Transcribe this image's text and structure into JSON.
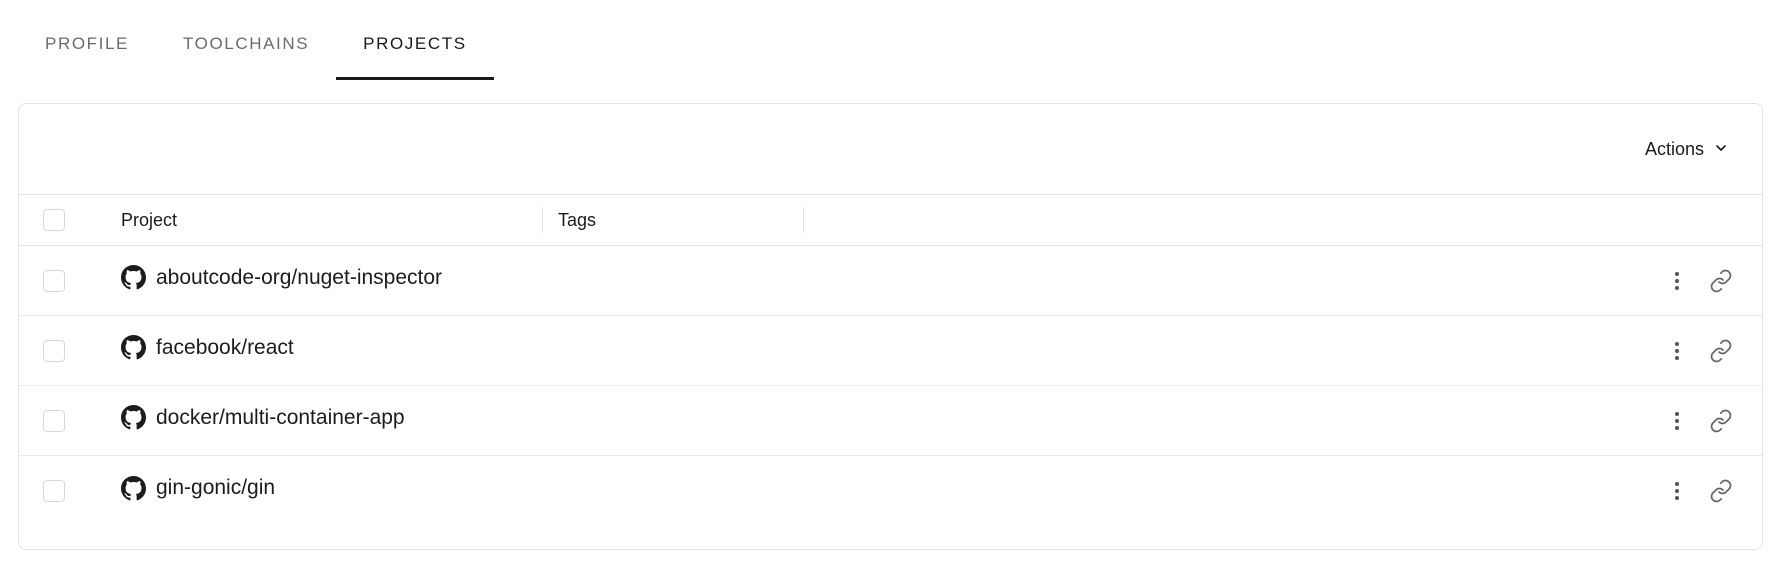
{
  "tabs": [
    {
      "label": "PROFILE",
      "active": false
    },
    {
      "label": "TOOLCHAINS",
      "active": false
    },
    {
      "label": "PROJECTS",
      "active": true
    }
  ],
  "toolbar": {
    "actions_label": "Actions"
  },
  "table": {
    "columns": {
      "project": "Project",
      "tags": "Tags"
    },
    "rows": [
      {
        "project": "aboutcode-org/nuget-inspector",
        "source_icon": "github-icon"
      },
      {
        "project": "facebook/react",
        "source_icon": "github-icon"
      },
      {
        "project": "docker/multi-container-app",
        "source_icon": "github-icon"
      },
      {
        "project": "gin-gonic/gin",
        "source_icon": "github-icon"
      }
    ]
  },
  "colors": {
    "active_tab": "#1a1a1a",
    "inactive_tab": "#6b6b6b",
    "border": "#e3e3e3"
  }
}
